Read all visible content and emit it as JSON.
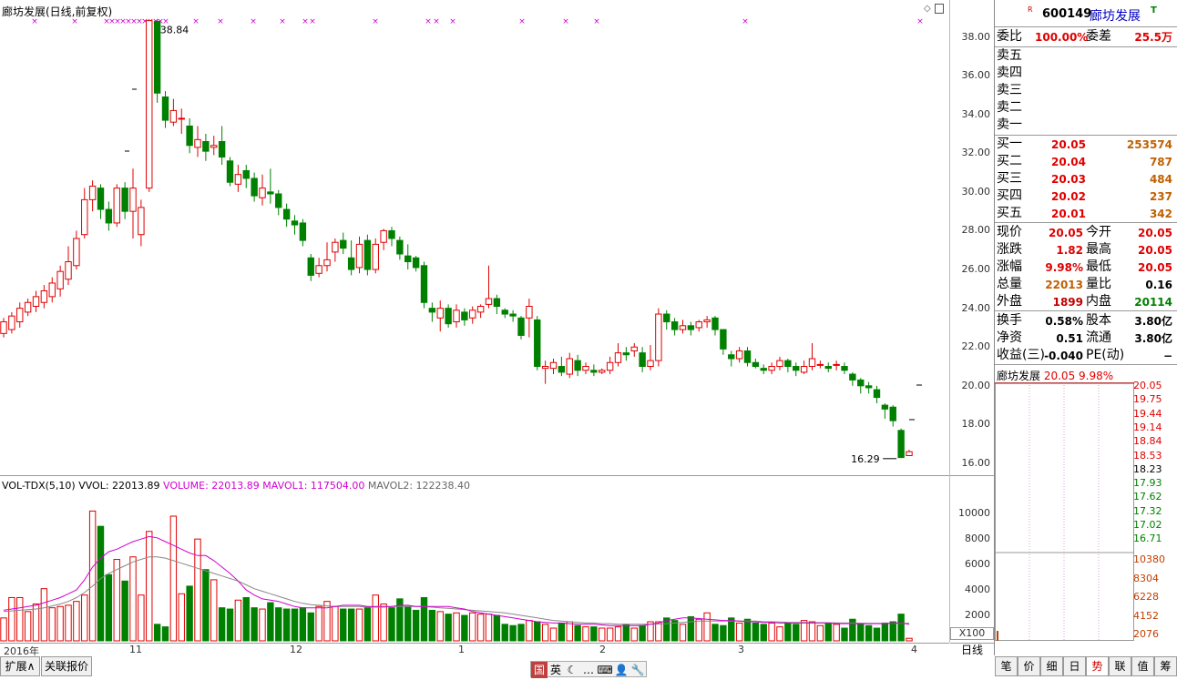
{
  "header": {
    "title": "廊坊发展(日线,前复权)",
    "high_marker": "38.84",
    "low_marker": "16.29"
  },
  "price_axis": [
    "38.00",
    "36.00",
    "34.00",
    "32.00",
    "30.00",
    "28.00",
    "26.00",
    "24.00",
    "22.00",
    "20.00",
    "18.00",
    "16.00"
  ],
  "volume_legend": {
    "name": "VOL-TDX(5,10)",
    "vvol": "VVOL: 22013.89",
    "volume": "VOLUME: 22013.89",
    "mavol1": "MAVOL1: 117504.00",
    "mavol2": "MAVOL2: 122238.40"
  },
  "volume_axis": [
    "10000",
    "8000",
    "6000",
    "4000",
    "2000"
  ],
  "volume_unit": "X100",
  "x_axis": [
    "2016年",
    "11",
    "12",
    "1",
    "2",
    "3",
    "4"
  ],
  "period_label": "日线",
  "bottom_tabs": [
    "扩展∧",
    "关联报价"
  ],
  "toolbar_icons": [
    "国",
    "英",
    "☾",
    "…",
    "⌨",
    "👤",
    "🔧"
  ],
  "quote": {
    "code": "600149",
    "name": "廊坊发展",
    "weibi_label": "委比",
    "weibi": "100.00%",
    "weicha_label": "委差",
    "weicha": "25.5万",
    "sell": [
      {
        "label": "卖五"
      },
      {
        "label": "卖四"
      },
      {
        "label": "卖三"
      },
      {
        "label": "卖二"
      },
      {
        "label": "卖一"
      }
    ],
    "buy": [
      {
        "label": "买一",
        "price": "20.05",
        "vol": "253574"
      },
      {
        "label": "买二",
        "price": "20.04",
        "vol": "787"
      },
      {
        "label": "买三",
        "price": "20.03",
        "vol": "484"
      },
      {
        "label": "买四",
        "price": "20.02",
        "vol": "237"
      },
      {
        "label": "买五",
        "price": "20.01",
        "vol": "342"
      }
    ],
    "stats": [
      {
        "l1": "现价",
        "v1": "20.05",
        "l2": "今开",
        "v2": "20.05"
      },
      {
        "l1": "涨跌",
        "v1": "1.82",
        "l2": "最高",
        "v2": "20.05"
      },
      {
        "l1": "涨幅",
        "v1": "9.98%",
        "l2": "最低",
        "v2": "20.05"
      },
      {
        "l1": "总量",
        "v1": "22013",
        "l2": "量比",
        "v2": "0.16"
      },
      {
        "l1": "外盘",
        "v1": "1899",
        "l2": "内盘",
        "v2": "20114"
      }
    ],
    "stats2": [
      {
        "l1": "换手",
        "v1": "0.58%",
        "l2": "股本",
        "v2": "3.80亿"
      },
      {
        "l1": "净资",
        "v1": "0.51",
        "l2": "流通",
        "v2": "3.80亿"
      },
      {
        "l1": "收益(三)",
        "v1": "-0.040",
        "l2": "PE(动)",
        "v2": "−"
      }
    ],
    "minute_title": "廊坊发展",
    "minute_price": "20.05",
    "minute_pct": "9.98%",
    "minute_axis": [
      "20.05",
      "19.75",
      "19.44",
      "19.14",
      "18.84",
      "18.53",
      "18.23",
      "17.93",
      "17.62",
      "17.32",
      "17.02",
      "16.71"
    ],
    "minute_vol_axis": [
      "10380",
      "8304",
      "6228",
      "4152",
      "2076"
    ],
    "tabs": [
      "笔",
      "价",
      "细",
      "日",
      "势",
      "联",
      "值",
      "筹"
    ]
  },
  "colors": {
    "up": "#e00000",
    "down": "#008000",
    "ma1": "#d000d0",
    "ma2": "#888888"
  },
  "chart_data": {
    "type": "candlestick",
    "title": "廊坊发展(日线,前复权)",
    "ylim": [
      15.5,
      39.0
    ],
    "candles": [
      [
        22.7,
        23.3,
        22.5,
        23.5
      ],
      [
        22.9,
        23.6,
        22.7,
        23.8
      ],
      [
        23.3,
        24.0,
        23.0,
        24.3
      ],
      [
        23.8,
        24.3,
        23.6,
        24.5
      ],
      [
        24.1,
        24.6,
        23.8,
        24.9
      ],
      [
        24.3,
        24.9,
        24.0,
        25.2
      ],
      [
        24.6,
        25.3,
        24.3,
        25.6
      ],
      [
        25.0,
        25.9,
        24.6,
        26.2
      ],
      [
        25.5,
        26.4,
        25.2,
        27.2
      ],
      [
        26.2,
        27.6,
        26.0,
        28.0
      ],
      [
        27.8,
        29.6,
        27.6,
        30.2
      ],
      [
        29.6,
        30.3,
        29.0,
        30.6
      ],
      [
        30.2,
        29.1,
        28.6,
        30.4
      ],
      [
        29.1,
        28.4,
        28.0,
        29.5
      ],
      [
        28.4,
        30.2,
        28.2,
        30.4
      ],
      [
        30.2,
        29.0,
        28.6,
        30.5
      ],
      [
        29.0,
        30.2,
        27.6,
        31.2
      ],
      [
        27.8,
        29.2,
        27.2,
        29.6
      ],
      [
        30.2,
        38.84,
        30.0,
        38.84
      ],
      [
        38.8,
        35.1,
        34.6,
        38.9
      ],
      [
        34.9,
        33.7,
        33.3,
        35.2
      ],
      [
        33.6,
        34.2,
        33.4,
        34.8
      ],
      [
        33.8,
        33.8,
        33.0,
        34.3
      ],
      [
        33.4,
        32.4,
        32.0,
        33.8
      ],
      [
        32.3,
        32.7,
        31.8,
        33.4
      ],
      [
        32.6,
        32.1,
        31.6,
        33.0
      ],
      [
        32.3,
        32.4,
        31.9,
        32.9
      ],
      [
        32.6,
        31.8,
        31.4,
        33.4
      ],
      [
        31.6,
        30.5,
        30.3,
        31.8
      ],
      [
        30.4,
        30.9,
        30.0,
        31.4
      ],
      [
        31.1,
        30.7,
        30.2,
        31.4
      ],
      [
        30.7,
        29.8,
        29.5,
        31.0
      ],
      [
        29.7,
        30.2,
        29.3,
        30.9
      ],
      [
        30.0,
        29.9,
        29.4,
        31.2
      ],
      [
        29.9,
        29.2,
        28.8,
        30.1
      ],
      [
        29.1,
        28.6,
        28.2,
        29.4
      ],
      [
        28.5,
        28.3,
        27.8,
        28.8
      ],
      [
        28.4,
        27.5,
        27.2,
        28.6
      ],
      [
        26.6,
        25.7,
        25.4,
        26.8
      ],
      [
        25.8,
        26.2,
        25.6,
        26.6
      ],
      [
        26.2,
        26.5,
        25.9,
        27.4
      ],
      [
        26.9,
        27.4,
        26.4,
        27.6
      ],
      [
        27.5,
        27.1,
        26.8,
        27.9
      ],
      [
        26.6,
        26.0,
        25.7,
        27.5
      ],
      [
        26.1,
        27.3,
        25.8,
        27.7
      ],
      [
        27.5,
        26.0,
        25.7,
        27.8
      ],
      [
        26.0,
        27.3,
        25.8,
        27.6
      ],
      [
        27.4,
        28.0,
        27.0,
        28.1
      ],
      [
        28.0,
        27.6,
        27.2,
        28.2
      ],
      [
        27.5,
        26.8,
        26.5,
        27.7
      ],
      [
        26.7,
        26.4,
        26.0,
        27.3
      ],
      [
        26.6,
        26.1,
        25.9,
        26.7
      ],
      [
        26.2,
        24.3,
        24.0,
        26.4
      ],
      [
        24.0,
        23.8,
        23.3,
        24.3
      ],
      [
        23.5,
        24.0,
        22.8,
        24.4
      ],
      [
        24.0,
        23.2,
        23.0,
        24.2
      ],
      [
        23.3,
        23.9,
        23.0,
        24.2
      ],
      [
        23.8,
        23.4,
        23.1,
        24.0
      ],
      [
        23.5,
        23.9,
        23.2,
        24.1
      ],
      [
        23.8,
        24.1,
        23.5,
        24.2
      ],
      [
        24.2,
        24.5,
        24.0,
        26.2
      ],
      [
        24.5,
        24.1,
        23.7,
        24.7
      ],
      [
        23.9,
        23.7,
        23.5,
        24.0
      ],
      [
        23.7,
        23.6,
        23.3,
        23.9
      ],
      [
        23.5,
        22.6,
        22.4,
        23.6
      ],
      [
        23.5,
        24.1,
        22.5,
        24.5
      ],
      [
        23.4,
        21.0,
        20.8,
        23.6
      ],
      [
        20.9,
        21.0,
        20.1,
        21.3
      ],
      [
        20.9,
        21.2,
        20.6,
        21.4
      ],
      [
        21.0,
        20.7,
        20.5,
        21.5
      ],
      [
        20.6,
        21.4,
        20.4,
        21.7
      ],
      [
        21.3,
        20.8,
        20.5,
        21.6
      ],
      [
        20.8,
        21.0,
        20.6,
        21.2
      ],
      [
        20.8,
        20.7,
        20.5,
        21.1
      ],
      [
        20.7,
        20.8,
        20.6,
        20.9
      ],
      [
        20.8,
        21.2,
        20.6,
        21.5
      ],
      [
        21.2,
        21.7,
        21.0,
        22.2
      ],
      [
        21.7,
        21.6,
        21.3,
        22.0
      ],
      [
        21.8,
        22.0,
        21.5,
        22.2
      ],
      [
        21.7,
        21.0,
        20.7,
        22.0
      ],
      [
        21.0,
        21.3,
        20.8,
        22.1
      ],
      [
        21.3,
        23.7,
        21.0,
        24.0
      ],
      [
        23.7,
        23.3,
        22.9,
        23.9
      ],
      [
        23.3,
        22.9,
        22.6,
        23.5
      ],
      [
        22.9,
        23.1,
        22.7,
        23.4
      ],
      [
        23.1,
        22.9,
        22.6,
        23.3
      ],
      [
        23.0,
        23.3,
        22.8,
        23.4
      ],
      [
        23.3,
        23.4,
        23.0,
        23.6
      ],
      [
        23.5,
        22.9,
        22.6,
        23.6
      ],
      [
        22.9,
        21.9,
        21.6,
        22.9
      ],
      [
        21.6,
        21.4,
        21.0,
        21.8
      ],
      [
        21.4,
        21.8,
        21.2,
        22.0
      ],
      [
        21.8,
        21.2,
        21.0,
        22.0
      ],
      [
        21.2,
        21.0,
        20.9,
        21.4
      ],
      [
        20.9,
        20.8,
        20.6,
        21.1
      ],
      [
        20.8,
        21.0,
        20.6,
        21.2
      ],
      [
        21.0,
        21.3,
        20.8,
        21.5
      ],
      [
        21.3,
        21.0,
        20.7,
        21.4
      ],
      [
        21.0,
        20.8,
        20.5,
        21.2
      ],
      [
        20.7,
        21.0,
        20.6,
        21.3
      ],
      [
        21.0,
        21.4,
        20.8,
        22.2
      ],
      [
        21.1,
        21.1,
        20.9,
        21.3
      ],
      [
        21.0,
        20.9,
        20.7,
        21.2
      ],
      [
        21.1,
        21.1,
        20.8,
        21.3
      ],
      [
        21.0,
        20.8,
        20.6,
        21.2
      ],
      [
        20.6,
        20.3,
        20.0,
        20.7
      ],
      [
        20.3,
        20.0,
        19.6,
        20.4
      ],
      [
        20.0,
        19.9,
        19.6,
        20.2
      ],
      [
        19.8,
        19.4,
        19.1,
        20.0
      ],
      [
        19.0,
        18.8,
        18.3,
        19.1
      ],
      [
        18.9,
        18.2,
        17.9,
        19.0
      ],
      [
        17.7,
        16.3,
        16.29,
        17.8
      ],
      [
        16.4,
        16.6,
        16.4,
        16.7
      ]
    ],
    "volume": [
      1800,
      3400,
      3400,
      2300,
      2900,
      4100,
      2600,
      2700,
      2800,
      3100,
      3600,
      10200,
      9000,
      5200,
      6400,
      4700,
      6600,
      3600,
      8600,
      1300,
      1100,
      9800,
      3700,
      4300,
      8000,
      5600,
      4800,
      2600,
      2500,
      3200,
      3400,
      2600,
      2500,
      3000,
      2600,
      2500,
      2500,
      2600,
      2200,
      2700,
      3100,
      2700,
      2500,
      2500,
      2500,
      2600,
      3600,
      2900,
      2600,
      3300,
      2700,
      2400,
      3400,
      2400,
      2300,
      2100,
      2200,
      2000,
      2200,
      2100,
      2100,
      2000,
      1300,
      1200,
      1300,
      1600,
      1500,
      1300,
      1000,
      1400,
      1500,
      1200,
      1100,
      1100,
      1000,
      1000,
      1100,
      1300,
      1000,
      1200,
      1500,
      1500,
      1800,
      1600,
      1300,
      1900,
      1700,
      2200,
      1300,
      1200,
      1800,
      1400,
      1700,
      1400,
      1300,
      1400,
      1100,
      1400,
      1300,
      1600,
      1500,
      1200,
      1400,
      1300,
      1000,
      1700,
      1300,
      1200,
      1000,
      1400,
      1500,
      2100,
      200
    ],
    "mavol1": [
      2400,
      2500,
      2600,
      2700,
      2800,
      3000,
      3200,
      3400,
      3700,
      4000,
      4800,
      5800,
      6500,
      7000,
      7200,
      7500,
      7800,
      8000,
      8200,
      8100,
      7800,
      7500,
      7200,
      6900,
      6700,
      6700,
      6300,
      5800,
      5300,
      4700,
      4000,
      3600,
      3300,
      3200,
      3100,
      2900,
      2700,
      2600,
      2600,
      2600,
      2600,
      2700,
      2800,
      2800,
      2800,
      2700,
      2700,
      2700,
      2700,
      2800,
      2800,
      2700,
      2700,
      2700,
      2700,
      2700,
      2600,
      2500,
      2300,
      2200,
      2100,
      2000,
      1900,
      1800,
      1700,
      1600,
      1500,
      1450,
      1400,
      1400,
      1350,
      1300,
      1300,
      1300,
      1250,
      1200,
      1200,
      1200,
      1200,
      1200,
      1300,
      1400,
      1600,
      1700,
      1800,
      1800,
      1750,
      1700,
      1650,
      1600,
      1600,
      1550,
      1500,
      1500,
      1450,
      1450,
      1400,
      1400,
      1400,
      1400,
      1400,
      1400,
      1400,
      1350,
      1350,
      1350,
      1350,
      1350,
      1350,
      1350,
      1400,
      1400,
      1300
    ],
    "mavol2": [
      2300,
      2350,
      2400,
      2450,
      2500,
      2600,
      2750,
      2900,
      3100,
      3400,
      3800,
      4300,
      4900,
      5300,
      5600,
      5900,
      6200,
      6400,
      6600,
      6600,
      6500,
      6300,
      6100,
      5900,
      5700,
      5500,
      5300,
      5100,
      4900,
      4700,
      4400,
      4100,
      3900,
      3700,
      3500,
      3300,
      3100,
      2950,
      2850,
      2800,
      2750,
      2700,
      2700,
      2700,
      2700,
      2650,
      2650,
      2650,
      2700,
      2700,
      2700,
      2700,
      2700,
      2650,
      2600,
      2550,
      2500,
      2450,
      2400,
      2350,
      2300,
      2250,
      2200,
      2100,
      2000,
      1900,
      1800,
      1700,
      1600,
      1550,
      1500,
      1450,
      1400,
      1400,
      1350,
      1350,
      1300,
      1300,
      1300,
      1300,
      1300,
      1320,
      1350,
      1400,
      1450,
      1500,
      1550,
      1550,
      1550,
      1550,
      1550,
      1550,
      1550,
      1550,
      1500,
      1500,
      1480,
      1460,
      1450,
      1450,
      1440,
      1430,
      1420,
      1410,
      1400,
      1400,
      1390,
      1380,
      1380,
      1380,
      1380,
      1380,
      1380
    ]
  }
}
